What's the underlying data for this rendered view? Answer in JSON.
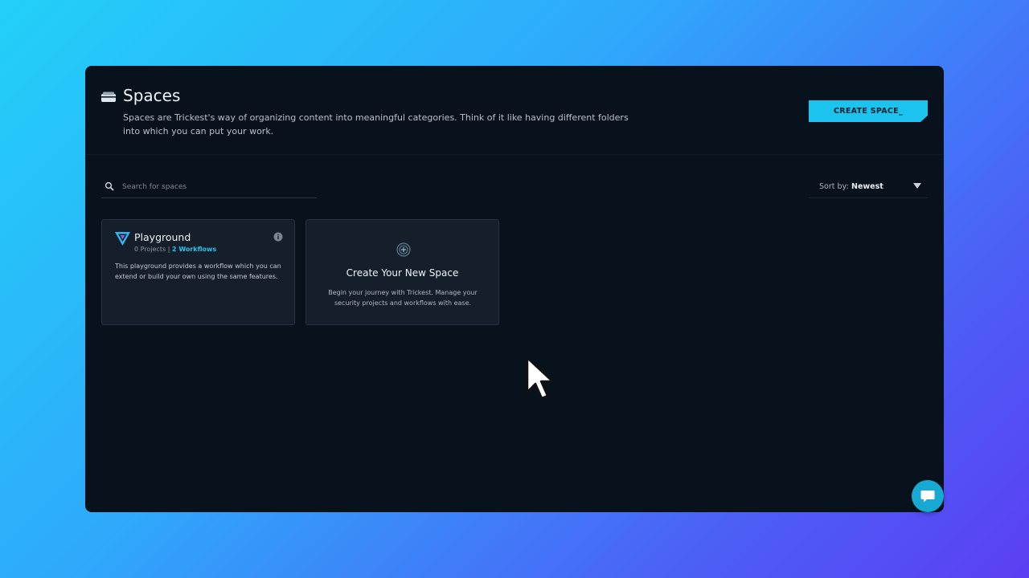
{
  "header": {
    "icon": "spaces-folder-icon",
    "title": "Spaces",
    "description": "Spaces are Trickest's way of organizing content into meaningful categories. Think of it like having different folders into which you can put your work.",
    "create_button_label": "CREATE SPACE_"
  },
  "toolbar": {
    "search": {
      "placeholder": "Search for spaces",
      "value": "",
      "icon": "search-icon"
    },
    "sort": {
      "label": "Sort by:",
      "value": "Newest",
      "icon": "caret-down-icon"
    }
  },
  "spaces": [
    {
      "name": "Playground",
      "icon": "trickest-logo-icon",
      "projects_text": "0 Projects",
      "separator": "|",
      "workflows_text": "2 Workflows",
      "description": "This playground provides a workflow which you can extend or build your own using the same features.",
      "info_icon": "info-icon"
    }
  ],
  "new_space_card": {
    "icon": "add-space-icon",
    "title": "Create Your New Space",
    "description": "Begin your journey with Trickest. Manage your security projects and workflows with ease."
  },
  "chat_widget": {
    "icon": "chat-bubble-icon"
  },
  "colors": {
    "accent": "#1bc3ee",
    "window_background": "#08121c",
    "card_background": "#151f2b",
    "link": "#27c4ef"
  }
}
